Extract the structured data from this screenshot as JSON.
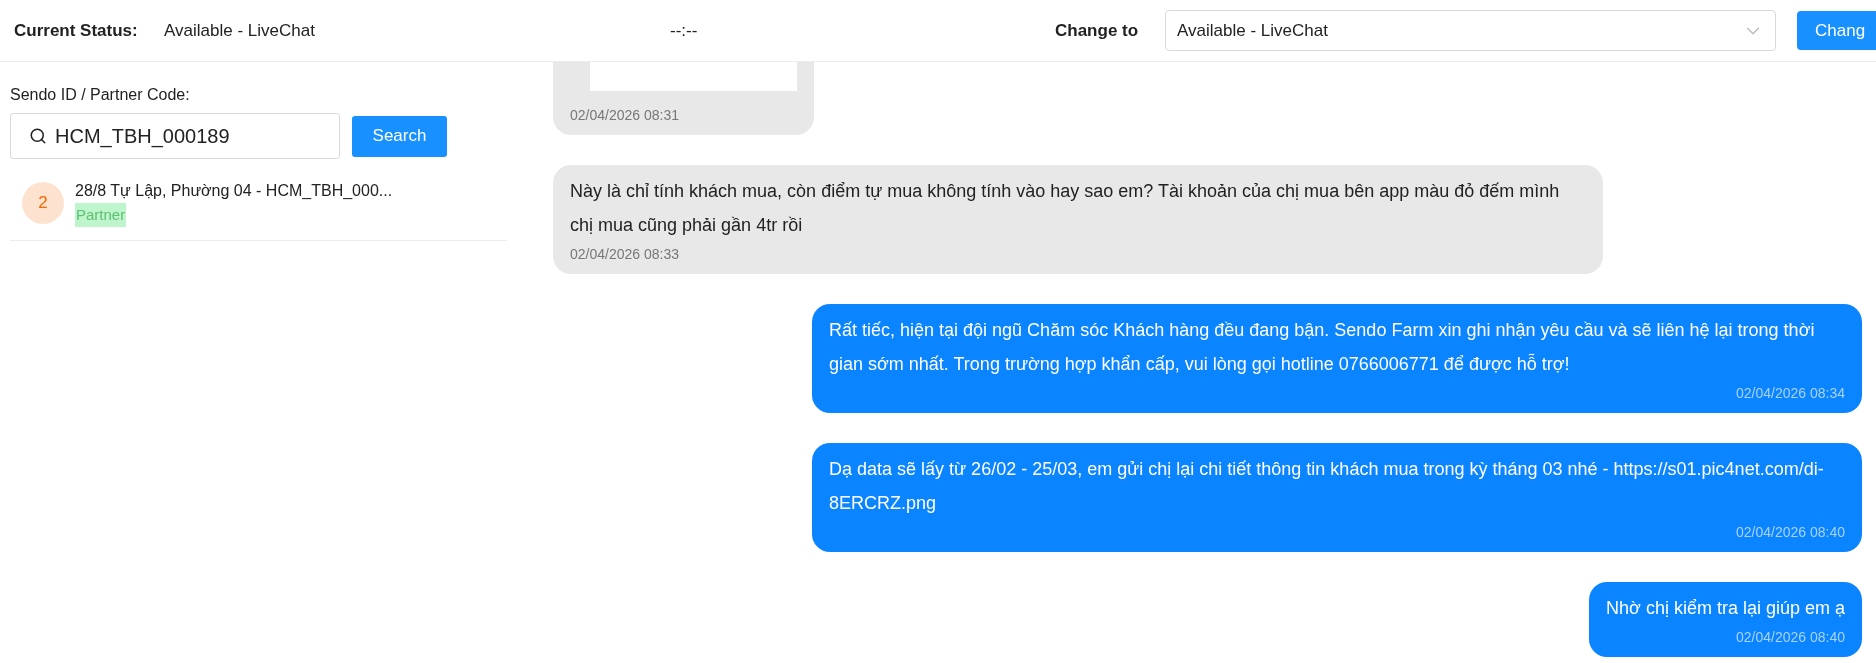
{
  "header": {
    "current_status_label": "Current Status:",
    "current_status": "Available - LiveChat",
    "timer": "--:--",
    "change_to_label": "Change to",
    "change_to_select": {
      "value": "Available - LiveChat"
    },
    "change_button": "Chang"
  },
  "search": {
    "label": "Sendo ID / Partner Code:",
    "value": "HCM_TBH_000189",
    "button": "Search"
  },
  "results": [
    {
      "count": "2",
      "title": "28/8 Tự Lập, Phường 04 - HCM_TBH_000...",
      "tag": "Partner"
    }
  ],
  "messages": [
    {
      "outgoing": false,
      "kind": "image",
      "time": "02/04/2026 08:31"
    },
    {
      "outgoing": false,
      "kind": "text",
      "text": "Này là chỉ tính khách mua, còn điểm tự mua không tính vào hay sao em? Tài khoản của chị mua bên app màu đỏ đếm mình chị mua cũng phải gần 4tr rồi",
      "time": "02/04/2026 08:33"
    },
    {
      "outgoing": true,
      "kind": "text",
      "text": "Rất tiếc, hiện tại đội ngũ Chăm sóc Khách hàng đều đang bận. Sendo Farm xin ghi nhận yêu cầu và sẽ liên hệ lại trong thời gian sớm nhất. Trong trường hợp khẩn cấp, vui lòng gọi hotline 0766006771 để được hỗ trợ!",
      "time": "02/04/2026 08:34"
    },
    {
      "outgoing": true,
      "kind": "text",
      "text": "Dạ data sẽ lấy từ 26/02 - 25/03, em gửi chị lại chi tiết thông tin khách mua trong kỳ tháng 03 nhé - https://s01.pic4net.com/di-8ERCRZ.png",
      "time": "02/04/2026 08:40"
    },
    {
      "outgoing": true,
      "kind": "text",
      "text": "Nhờ chị kiểm tra lại giúp em ạ",
      "time": "02/04/2026 08:40"
    }
  ]
}
